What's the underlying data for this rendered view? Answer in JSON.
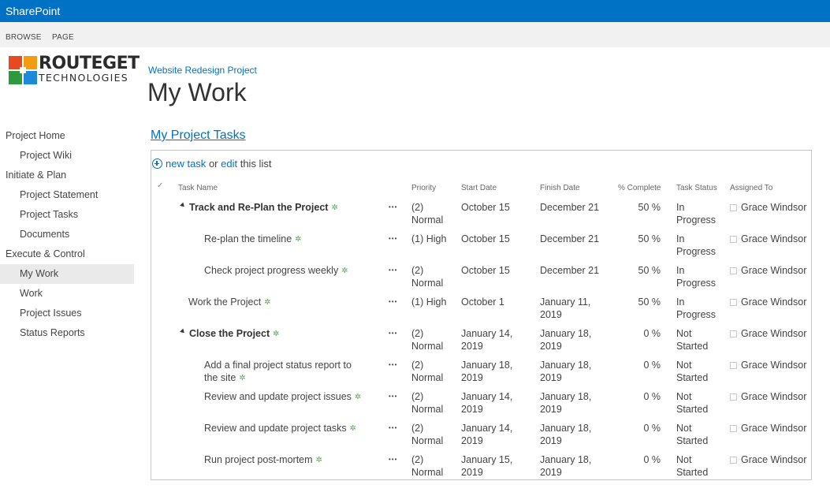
{
  "suitebar": {
    "brand": "SharePoint"
  },
  "ribbon": {
    "tabs": [
      "BROWSE",
      "PAGE"
    ]
  },
  "logo": {
    "line1": "ROUTEGET",
    "line2": "TECHNOLOGIES"
  },
  "header": {
    "breadcrumb": "Website Redesign Project",
    "title": "My Work"
  },
  "nav": [
    {
      "label": "Project Home",
      "level": 0
    },
    {
      "label": "Project Wiki",
      "level": 1
    },
    {
      "label": "Initiate & Plan",
      "level": 0
    },
    {
      "label": "Project Statement",
      "level": 1
    },
    {
      "label": "Project Tasks",
      "level": 1
    },
    {
      "label": "Documents",
      "level": 1
    },
    {
      "label": "Execute & Control",
      "level": 0
    },
    {
      "label": "My Work",
      "level": 1,
      "selected": true
    },
    {
      "label": "Work",
      "level": 1
    },
    {
      "label": "Project Issues",
      "level": 1
    },
    {
      "label": "Status Reports",
      "level": 1
    }
  ],
  "webpart": {
    "title": "My Project Tasks",
    "new_task": "new task",
    "or": "or",
    "edit": "edit",
    "this_list": "this list"
  },
  "columns": {
    "check": "✓",
    "task_name": "Task Name",
    "priority": "Priority",
    "start": "Start Date",
    "finish": "Finish Date",
    "complete": "% Complete",
    "status": "Task Status",
    "assigned": "Assigned To"
  },
  "tasks": [
    {
      "name": "Track and Re-Plan the Project",
      "indent": 1,
      "summary": true,
      "priority": "(2) Normal",
      "start": "October 15",
      "finish": "December 21",
      "complete": "50 %",
      "status": "In Progress",
      "assigned": "Grace Windsor"
    },
    {
      "name": "Re-plan the timeline",
      "indent": 2,
      "summary": false,
      "priority": "(1) High",
      "start": "October 15",
      "finish": "December 21",
      "complete": "50 %",
      "status": "In Progress",
      "assigned": "Grace Windsor"
    },
    {
      "name": "Check project progress weekly",
      "indent": 2,
      "summary": false,
      "priority": "(2) Normal",
      "start": "October 15",
      "finish": "December 21",
      "complete": "50 %",
      "status": "In Progress",
      "assigned": "Grace Windsor"
    },
    {
      "name": "Work the Project",
      "indent": 0,
      "summary": false,
      "priority": "(1) High",
      "start": "October 1",
      "finish": "January 11, 2019",
      "complete": "50 %",
      "status": "In Progress",
      "assigned": "Grace Windsor"
    },
    {
      "name": "Close the Project",
      "indent": 1,
      "summary": true,
      "priority": "(2) Normal",
      "start": "January 14, 2019",
      "finish": "January 18, 2019",
      "complete": "0 %",
      "status": "Not Started",
      "assigned": "Grace Windsor"
    },
    {
      "name": "Add a final project status report to the site",
      "indent": 2,
      "summary": false,
      "priority": "(2) Normal",
      "start": "January 18, 2019",
      "finish": "January 18, 2019",
      "complete": "0 %",
      "status": "Not Started",
      "assigned": "Grace Windsor"
    },
    {
      "name": "Review and update project issues",
      "indent": 2,
      "summary": false,
      "priority": "(2) Normal",
      "start": "January 14, 2019",
      "finish": "January 18, 2019",
      "complete": "0 %",
      "status": "Not Started",
      "assigned": "Grace Windsor"
    },
    {
      "name": "Review and update project tasks",
      "indent": 2,
      "summary": false,
      "priority": "(2) Normal",
      "start": "January 14, 2019",
      "finish": "January 18, 2019",
      "complete": "0 %",
      "status": "Not Started",
      "assigned": "Grace Windsor"
    },
    {
      "name": "Run project post-mortem",
      "indent": 2,
      "summary": false,
      "priority": "(2) Normal",
      "start": "January 15, 2019",
      "finish": "January 18, 2019",
      "complete": "0 %",
      "status": "Not Started",
      "assigned": "Grace Windsor"
    }
  ],
  "colors": {
    "suitebar": "#0072c6",
    "link": "#0072c6",
    "new_icon": "#4caf50"
  }
}
